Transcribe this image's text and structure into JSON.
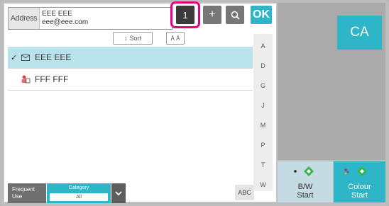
{
  "address": {
    "label": "Address",
    "name": "EEE EEE",
    "email": "eee@eee.com"
  },
  "toolbar": {
    "count": "1",
    "add_symbol": "+",
    "ok_label": "OK",
    "sort_label": "Sort",
    "kana_label": "Ā Ā"
  },
  "contacts": [
    {
      "name": "EEE EEE",
      "selected": true,
      "icon": "email-icon"
    },
    {
      "name": "FFF FFF",
      "selected": false,
      "icon": "group-contact-icon"
    }
  ],
  "index_letters": [
    "A",
    "D",
    "G",
    "J",
    "M",
    "P",
    "T",
    "W"
  ],
  "abc_label": "ABC",
  "frequent_use": {
    "line1": "Frequent",
    "line2": "Use"
  },
  "category": {
    "label": "Category",
    "value": "All"
  },
  "ca_label": "CA",
  "start_bw": {
    "line1": "B/W",
    "line2": "Start"
  },
  "start_colour": {
    "line1": "Colour",
    "line2": "Start"
  },
  "colors": {
    "accent": "#2eb5c7",
    "highlight_ring": "#e4007f",
    "start_green": "#39b54a"
  }
}
